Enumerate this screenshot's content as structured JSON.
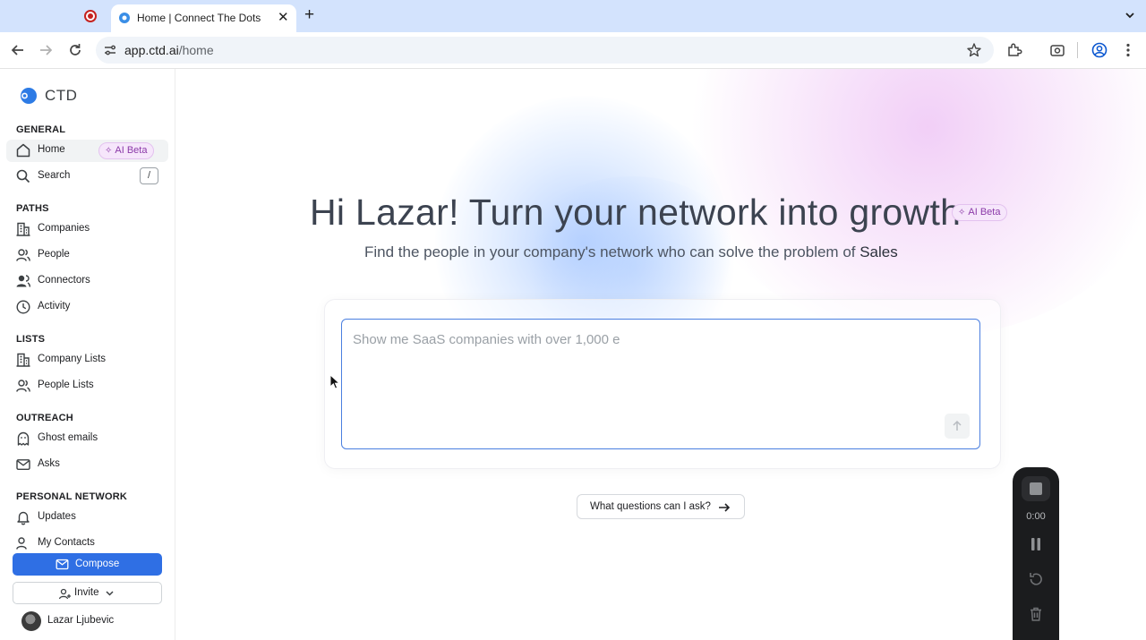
{
  "browser": {
    "tab_title": "Home | Connect The Dots",
    "url_host": "app.ctd.ai",
    "url_path": "/home"
  },
  "sidebar": {
    "brand": "CTD",
    "sections": {
      "general": "GENERAL",
      "paths": "PATHS",
      "lists": "LISTS",
      "outreach": "OUTREACH",
      "personal": "PERSONAL NETWORK"
    },
    "items": {
      "home": "Home",
      "home_badge": "AI Beta",
      "search": "Search",
      "search_shortcut": "/",
      "companies": "Companies",
      "people": "People",
      "connectors": "Connectors",
      "activity": "Activity",
      "company_lists": "Company Lists",
      "people_lists": "People Lists",
      "ghost_emails": "Ghost emails",
      "asks": "Asks",
      "updates": "Updates",
      "my_contacts": "My Contacts"
    },
    "compose_label": "Compose",
    "invite_label": "Invite",
    "user_name": "Lazar Ljubevic"
  },
  "main": {
    "title": "Hi Lazar! Turn your network into growth",
    "title_badge": "AI Beta",
    "subtitle_prefix": "Find the people in your company's network who can solve the problem of ",
    "subtitle_topic": "Sales",
    "prompt_placeholder": "Show me SaaS companies with over 1,000 e",
    "ask_button": "What questions can I ask?"
  },
  "recorder": {
    "time": "0:00"
  },
  "colors": {
    "accent": "#2f6fe4",
    "badge_text": "#8b3aa8",
    "badge_bg": "#f6e6fb",
    "chrome_tabbar": "#d3e3fd"
  }
}
